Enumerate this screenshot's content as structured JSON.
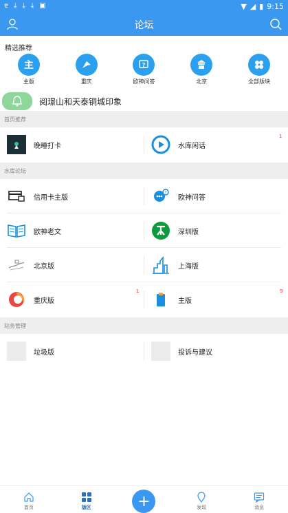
{
  "status_bar": {
    "time": "9:15"
  },
  "app_bar": {
    "title": "论坛"
  },
  "featured": {
    "title": "精选推荐",
    "items": [
      {
        "label": "主版",
        "glyph": "主"
      },
      {
        "label": "重庆",
        "glyph": ""
      },
      {
        "label": "欧神问答",
        "glyph": "?"
      },
      {
        "label": "北京",
        "glyph": ""
      },
      {
        "label": "全部版块",
        "glyph": ""
      }
    ]
  },
  "notice": {
    "text": "阅璟山和天泰铜城印象"
  },
  "sections": {
    "home": {
      "title": "首页推荐",
      "rows": [
        {
          "left": {
            "label": "晚睡打卡",
            "icon": "night-photo-icon"
          },
          "right": {
            "label": "水库闲话",
            "icon": "play-circle-icon",
            "badge": "1"
          }
        }
      ]
    },
    "forum": {
      "title": "水库论坛",
      "rows": [
        {
          "left": {
            "label": "信用卡主版",
            "icon": "credit-card-icon"
          },
          "right": {
            "label": "欧神问答",
            "icon": "qa-icon"
          }
        },
        {
          "left": {
            "label": "欧神老文",
            "icon": "book-icon"
          },
          "right": {
            "label": "深圳版",
            "icon": "shenzhen-metro-icon"
          }
        },
        {
          "left": {
            "label": "北京版",
            "icon": "beijing-icon"
          },
          "right": {
            "label": "上海版",
            "icon": "shanghai-icon"
          }
        },
        {
          "left": {
            "label": "重庆版",
            "icon": "chongqing-icon",
            "badge": "1"
          },
          "right": {
            "label": "主版",
            "icon": "main-board-icon",
            "badge": "9"
          }
        }
      ]
    },
    "admin": {
      "title": "站务管理",
      "rows": [
        {
          "left": {
            "label": "垃圾版",
            "icon": "placeholder-icon"
          },
          "right": {
            "label": "投诉与建议",
            "icon": "placeholder-icon"
          }
        }
      ]
    }
  },
  "bottom_nav": [
    {
      "label": "首页",
      "icon": "home-icon"
    },
    {
      "label": "版区",
      "icon": "grid-icon"
    },
    {
      "label": "",
      "icon": "plus-icon"
    },
    {
      "label": "发现",
      "icon": "location-pin-icon"
    },
    {
      "label": "消息",
      "icon": "message-icon"
    }
  ],
  "colors": {
    "primary": "#3a98f0",
    "accent": "#2aa0ee",
    "badge": "#f04040"
  }
}
